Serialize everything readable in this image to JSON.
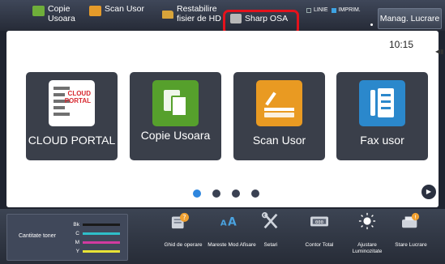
{
  "topbar": {
    "shortcuts": [
      {
        "label": "Copie Usoara",
        "icon": "copy-icon"
      },
      {
        "label": "Scan Usor",
        "icon": "scan-icon"
      },
      {
        "label": "Restabilire fisier de HD",
        "icon": "folder-icon"
      }
    ],
    "sharp_osa_label": "Sharp OSA",
    "status": {
      "line": "LINIE",
      "print": "IMPRIM."
    },
    "job_status_label": "Manag. Lucrare"
  },
  "clock": "10:15",
  "tiles": [
    {
      "label": "CLOUD PORTAL",
      "icon": "cloud-portal-icon",
      "icon_text": "CLOUD\nPORTAL"
    },
    {
      "label": "Copie Usoara",
      "icon": "copy-icon"
    },
    {
      "label": "Scan Usor",
      "icon": "scan-icon"
    },
    {
      "label": "Fax usor",
      "icon": "fax-icon"
    }
  ],
  "page_indicator": {
    "pages": 4,
    "current": 1
  },
  "toner": {
    "label": "Cantitate toner",
    "levels": [
      {
        "name": "Bk",
        "color": "#222222",
        "level": 1.0
      },
      {
        "name": "C",
        "color": "#2fbfc9",
        "level": 1.0
      },
      {
        "name": "M",
        "color": "#d23ba0",
        "level": 1.0
      },
      {
        "name": "Y",
        "color": "#e8e337",
        "level": 1.0
      }
    ]
  },
  "bottom_buttons": [
    {
      "label": "Ghid de operare",
      "icon": "operation-guide-icon"
    },
    {
      "label": "Mareste Mod Afisare",
      "icon": "enlarge-display-icon"
    },
    {
      "label": "Setari",
      "icon": "settings-icon"
    },
    {
      "label": "Contor Total",
      "icon": "total-count-icon"
    },
    {
      "label": "Ajustare Luminozitate",
      "icon": "brightness-icon"
    },
    {
      "label": "Stare Lucrare",
      "icon": "job-status-icon"
    }
  ]
}
